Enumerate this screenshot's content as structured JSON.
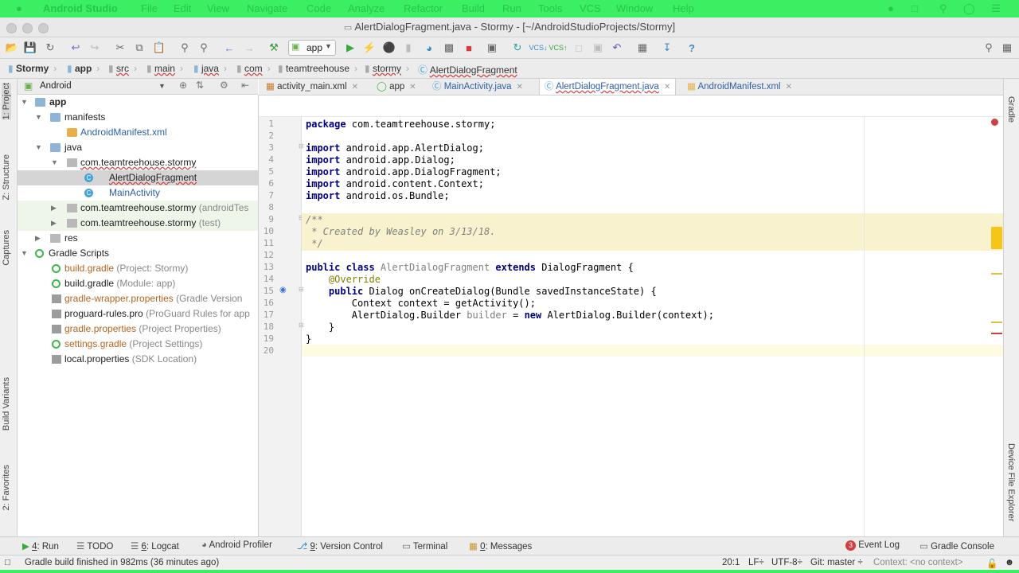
{
  "colors": {
    "menubar": "#3bee62",
    "keyword": "#000080",
    "comment": "#808080",
    "annotation": "#808000",
    "doc_highlight": "#f8f2cf",
    "error": "#d04040"
  },
  "menubar": {
    "apple": "",
    "items": [
      "Android Studio",
      "File",
      "Edit",
      "View",
      "Navigate",
      "Code",
      "Analyze",
      "Refactor",
      "Build",
      "Run",
      "Tools",
      "VCS",
      "Window",
      "Help"
    ]
  },
  "window": {
    "title": "AlertDialogFragment.java - Stormy - [~/AndroidStudioProjects/Stormy]"
  },
  "toolbar": {
    "run_config": "app"
  },
  "breadcrumbs": [
    "Stormy",
    "app",
    "src",
    "main",
    "java",
    "com",
    "teamtreehouse",
    "stormy",
    "AlertDialogFragment"
  ],
  "project_panel": {
    "view_selector": "Android",
    "tree": [
      {
        "label": "app",
        "hint": ""
      },
      {
        "label": "manifests",
        "hint": ""
      },
      {
        "label": "AndroidManifest.xml",
        "hint": ""
      },
      {
        "label": "java",
        "hint": ""
      },
      {
        "label": "com.teamtreehouse.stormy",
        "hint": ""
      },
      {
        "label": "AlertDialogFragment",
        "hint": ""
      },
      {
        "label": "MainActivity",
        "hint": ""
      },
      {
        "label": "com.teamtreehouse.stormy",
        "hint": "(androidTes"
      },
      {
        "label": "com.teamtreehouse.stormy",
        "hint": "(test)"
      },
      {
        "label": "res",
        "hint": ""
      },
      {
        "label": "Gradle Scripts",
        "hint": ""
      },
      {
        "label": "build.gradle",
        "hint": "(Project: Stormy)"
      },
      {
        "label": "build.gradle",
        "hint": "(Module: app)"
      },
      {
        "label": "gradle-wrapper.properties",
        "hint": "(Gradle Version"
      },
      {
        "label": "proguard-rules.pro",
        "hint": "(ProGuard Rules for app"
      },
      {
        "label": "gradle.properties",
        "hint": "(Project Properties)"
      },
      {
        "label": "settings.gradle",
        "hint": "(Project Settings)"
      },
      {
        "label": "local.properties",
        "hint": "(SDK Location)"
      }
    ]
  },
  "left_tool_tabs": [
    "1: Project",
    "Z: Structure",
    "Captures",
    "Build Variants",
    "2: Favorites"
  ],
  "right_tool_tabs": [
    "Gradle",
    "Device File Explorer"
  ],
  "editor_tabs": [
    "activity_main.xml",
    "app",
    "MainActivity.java",
    "AlertDialogFragment.java",
    "AndroidManifest.xml"
  ],
  "code": {
    "line_numbers": [
      "1",
      "2",
      "3",
      "4",
      "5",
      "6",
      "7",
      "8",
      "9",
      "10",
      "11",
      "12",
      "13",
      "14",
      "15",
      "16",
      "17",
      "18",
      "19",
      "20"
    ],
    "l1_kw": "package",
    "l1_rest": " com.teamtreehouse.stormy;",
    "l3_kw": "import",
    "l3_rest": " android.app.AlertDialog;",
    "l4_kw": "import",
    "l4_rest": " android.app.Dialog;",
    "l5_kw": "import",
    "l5_rest": " android.app.DialogFragment;",
    "l6_kw": "import",
    "l6_rest": " android.content.Context;",
    "l7_kw": "import",
    "l7_rest": " android.os.Bundle;",
    "l9": "/**",
    "l10": " * Created by Weasley on 3/13/18.",
    "l11": " */",
    "l13_kw1": "public class",
    "l13_name": " AlertDialogFragment ",
    "l13_kw2": "extends",
    "l13_rest": " DialogFragment {",
    "l14": "    @Override",
    "l15_kw": "    public",
    "l15_rest": " Dialog onCreateDialog(Bundle savedInstanceState) {",
    "l16": "        Context context = getActivity();",
    "l17_a": "        AlertDialog.Builder ",
    "l17_var": "builder",
    "l17_b": " = ",
    "l17_kw": "new",
    "l17_c": " AlertDialog.Builder(context);",
    "l18": "    }",
    "l19": "}"
  },
  "bottom_tools": [
    {
      "key": "4",
      "label": ": Run"
    },
    {
      "key": "",
      "label": "TODO"
    },
    {
      "key": "6",
      "label": ": Logcat"
    },
    {
      "key": "",
      "label": "Android Profiler"
    },
    {
      "key": "9",
      "label": ": Version Control"
    },
    {
      "key": "",
      "label": "Terminal"
    },
    {
      "key": "0",
      "label": ": Messages"
    },
    {
      "key": "",
      "label": "Event Log"
    },
    {
      "key": "",
      "label": "Gradle Console"
    }
  ],
  "event_log_count": "3",
  "status": {
    "message": "Gradle build finished in 982ms (36 minutes ago)",
    "position": "20:1",
    "line_sep": "LF÷",
    "encoding": "UTF-8÷",
    "git": "Git: master ÷",
    "context": "Context: <no context>"
  }
}
